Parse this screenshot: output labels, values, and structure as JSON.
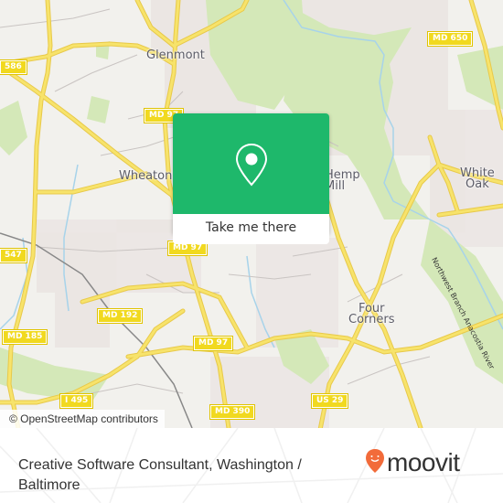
{
  "map": {
    "places": [
      {
        "id": "glenmont",
        "label": "Glenmont"
      },
      {
        "id": "wheaton",
        "label": "Wheaton"
      },
      {
        "id": "hemp-mill",
        "label": "Hemp\nMill"
      },
      {
        "id": "white-oak",
        "label": "White\nOak"
      },
      {
        "id": "four-corners",
        "label": "Four\nCorners"
      }
    ],
    "road_shields": [
      {
        "id": "md586",
        "label": "586"
      },
      {
        "id": "md97-top",
        "label": "MD 97"
      },
      {
        "id": "md650",
        "label": "MD 650"
      },
      {
        "id": "md547",
        "label": "547"
      },
      {
        "id": "md97-mid",
        "label": "MD 97"
      },
      {
        "id": "md192",
        "label": "MD 192"
      },
      {
        "id": "md185",
        "label": "MD 185"
      },
      {
        "id": "md97-low",
        "label": "MD 97"
      },
      {
        "id": "i495",
        "label": "I 495"
      },
      {
        "id": "md390",
        "label": "MD 390"
      },
      {
        "id": "us29",
        "label": "US 29"
      }
    ],
    "river_label": "Northwest Branch Anacostia River",
    "attribution": "© OpenStreetMap contributors",
    "colors": {
      "background": "#f2f1ed",
      "park": "#d4e8b8",
      "road": "#f7e36b",
      "water": "#a7d3ea"
    }
  },
  "popup": {
    "icon": "map-pin-icon",
    "button_label": "Take me there",
    "color": "#1eb86b"
  },
  "footer": {
    "title": "Creative Software Consultant, Washington / Baltimore",
    "brand": "moovit",
    "brand_color": "#f26b3a"
  }
}
